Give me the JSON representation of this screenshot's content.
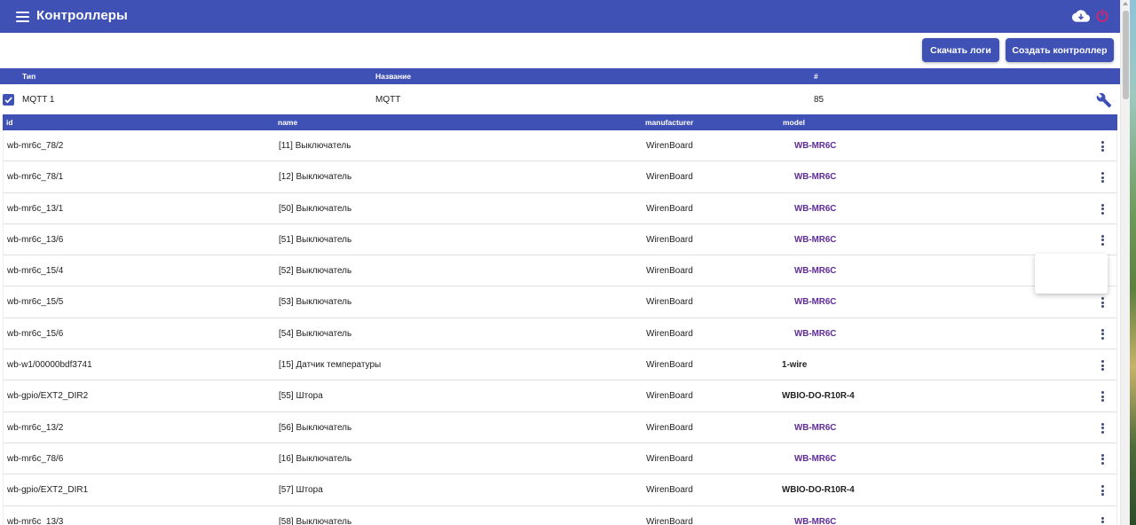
{
  "topbar": {
    "title": "Контроллеры",
    "icons": [
      "menu-icon",
      "cloud-icon",
      "power-icon"
    ],
    "colors": {
      "primary": "#3f51b5",
      "power": "#e91e63"
    }
  },
  "actions": {
    "download_logs": "Скачать логи",
    "create_controller": "Создать контроллер"
  },
  "controllers": {
    "columns": {
      "type": "Тип",
      "name": "Название",
      "number": "#"
    },
    "row": {
      "checked": true,
      "type": "MQTT 1",
      "name": "MQTT",
      "number": "85"
    }
  },
  "devices": {
    "columns": {
      "id": "id",
      "name": "name",
      "manufacturer": "manufacturer",
      "model": "model"
    },
    "rows": [
      {
        "id": "wb-mr6c_78/2",
        "name": "[11] Выключатель",
        "manufacturer": "WirenBoard",
        "model": "WB-MR6C",
        "model_link": true
      },
      {
        "id": "wb-mr6c_78/1",
        "name": "[12] Выключатель",
        "manufacturer": "WirenBoard",
        "model": "WB-MR6C",
        "model_link": true
      },
      {
        "id": "wb-mr6c_13/1",
        "name": "[50] Выключатель",
        "manufacturer": "WirenBoard",
        "model": "WB-MR6C",
        "model_link": true
      },
      {
        "id": "wb-mr6c_13/6",
        "name": "[51] Выключатель",
        "manufacturer": "WirenBoard",
        "model": "WB-MR6C",
        "model_link": true
      },
      {
        "id": "wb-mr6c_15/4",
        "name": "[52] Выключатель",
        "manufacturer": "WirenBoard",
        "model": "WB-MR6C",
        "model_link": true
      },
      {
        "id": "wb-mr6c_15/5",
        "name": "[53] Выключатель",
        "manufacturer": "WirenBoard",
        "model": "WB-MR6C",
        "model_link": true
      },
      {
        "id": "wb-mr6c_15/6",
        "name": "[54] Выключатель",
        "manufacturer": "WirenBoard",
        "model": "WB-MR6C",
        "model_link": true
      },
      {
        "id": "wb-w1/00000bdf3741",
        "name": "[15] Датчик температуры",
        "manufacturer": "WirenBoard",
        "model": "1-wire",
        "model_link": false
      },
      {
        "id": "wb-gpio/EXT2_DIR2",
        "name": "[55] Штора",
        "manufacturer": "WirenBoard",
        "model": "WBIO-DO-R10R-4",
        "model_link": false
      },
      {
        "id": "wb-mr6c_13/2",
        "name": "[56] Выключатель",
        "manufacturer": "WirenBoard",
        "model": "WB-MR6C",
        "model_link": true
      },
      {
        "id": "wb-mr6c_78/6",
        "name": "[16] Выключатель",
        "manufacturer": "WirenBoard",
        "model": "WB-MR6C",
        "model_link": true
      },
      {
        "id": "wb-gpio/EXT2_DIR1",
        "name": "[57] Штора",
        "manufacturer": "WirenBoard",
        "model": "WBIO-DO-R10R-4",
        "model_link": false
      },
      {
        "id": "wb-mr6c_13/3",
        "name": "[58] Выключатель",
        "manufacturer": "WirenBoard",
        "model": "WB-MR6C",
        "model_link": true
      }
    ]
  }
}
